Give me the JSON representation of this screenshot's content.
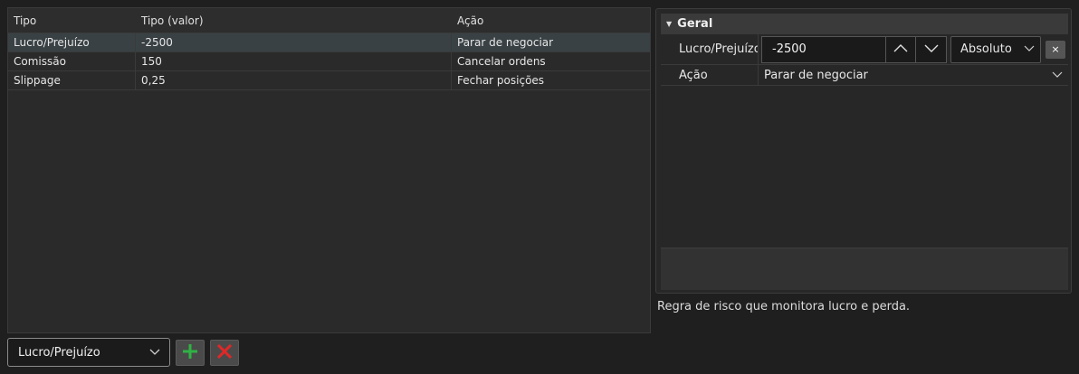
{
  "grid": {
    "columns": [
      "Tipo",
      "Tipo (valor)",
      "Ação"
    ],
    "rows": [
      {
        "tipo": "Lucro/Prejuízo",
        "valor": "-2500",
        "acao": "Parar de negociar"
      },
      {
        "tipo": "Comissão",
        "valor": "150",
        "acao": "Cancelar ordens"
      },
      {
        "tipo": "Slippage",
        "valor": "0,25",
        "acao": "Fechar posições"
      }
    ],
    "selected_row": 0
  },
  "controls": {
    "type_select_value": "Lucro/Prejuízo",
    "add_color": "#2fb344",
    "remove_color": "#e02828"
  },
  "properties": {
    "section_title": "Geral",
    "profit_loss_label": "Lucro/Prejuízo",
    "profit_loss_value": "-2500",
    "mode_value": "Absoluto",
    "clear_label": "×",
    "action_label": "Ação",
    "action_value": "Parar de negociar"
  },
  "description": "Regra de risco que monitora lucro e perda."
}
